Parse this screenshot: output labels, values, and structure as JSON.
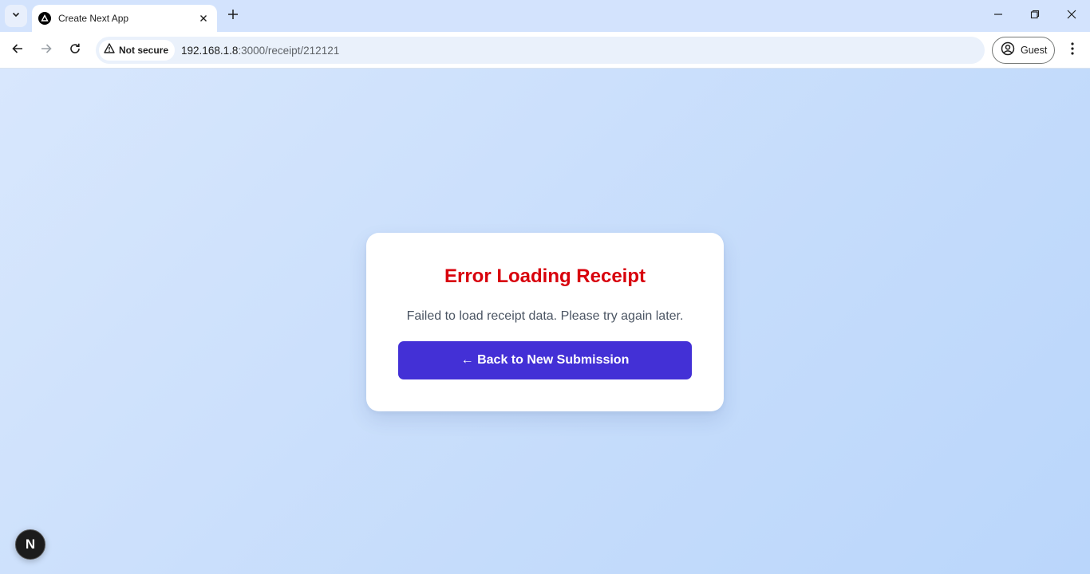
{
  "browser": {
    "tab_title": "Create Next App",
    "security_label": "Not secure",
    "url_host": "192.168.1.8",
    "url_path": ":3000/receipt/212121",
    "profile_label": "Guest"
  },
  "page": {
    "error_title": "Error Loading Receipt",
    "error_message": "Failed to load receipt data. Please try again later.",
    "back_button_label": "← Back to New Submission",
    "next_badge_letter": "N"
  },
  "colors": {
    "error_title": "#d8000c",
    "button_bg": "#4330d6",
    "page_bg": "#d3e3fd"
  }
}
